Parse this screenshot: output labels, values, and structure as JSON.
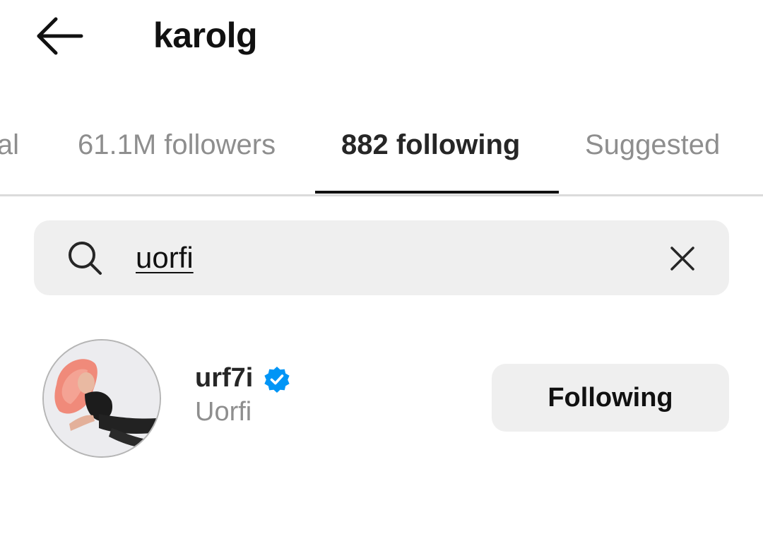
{
  "header": {
    "title": "karolg",
    "back_icon": "arrow-left-icon"
  },
  "tabs": [
    {
      "label": "Mutual",
      "active": false
    },
    {
      "label": "61.1M followers",
      "active": false
    },
    {
      "label": "882 following",
      "active": true
    },
    {
      "label": "Suggested",
      "active": false
    }
  ],
  "search": {
    "value": "uorfi",
    "search_icon": "search-icon",
    "clear_icon": "close-icon"
  },
  "results": [
    {
      "username": "urf7i",
      "verified": true,
      "full_name": "Uorfi",
      "button_label": "Following"
    }
  ],
  "colors": {
    "verified": "#0095f6",
    "muted_text": "#8e8e8e",
    "button_bg": "#efefef"
  }
}
